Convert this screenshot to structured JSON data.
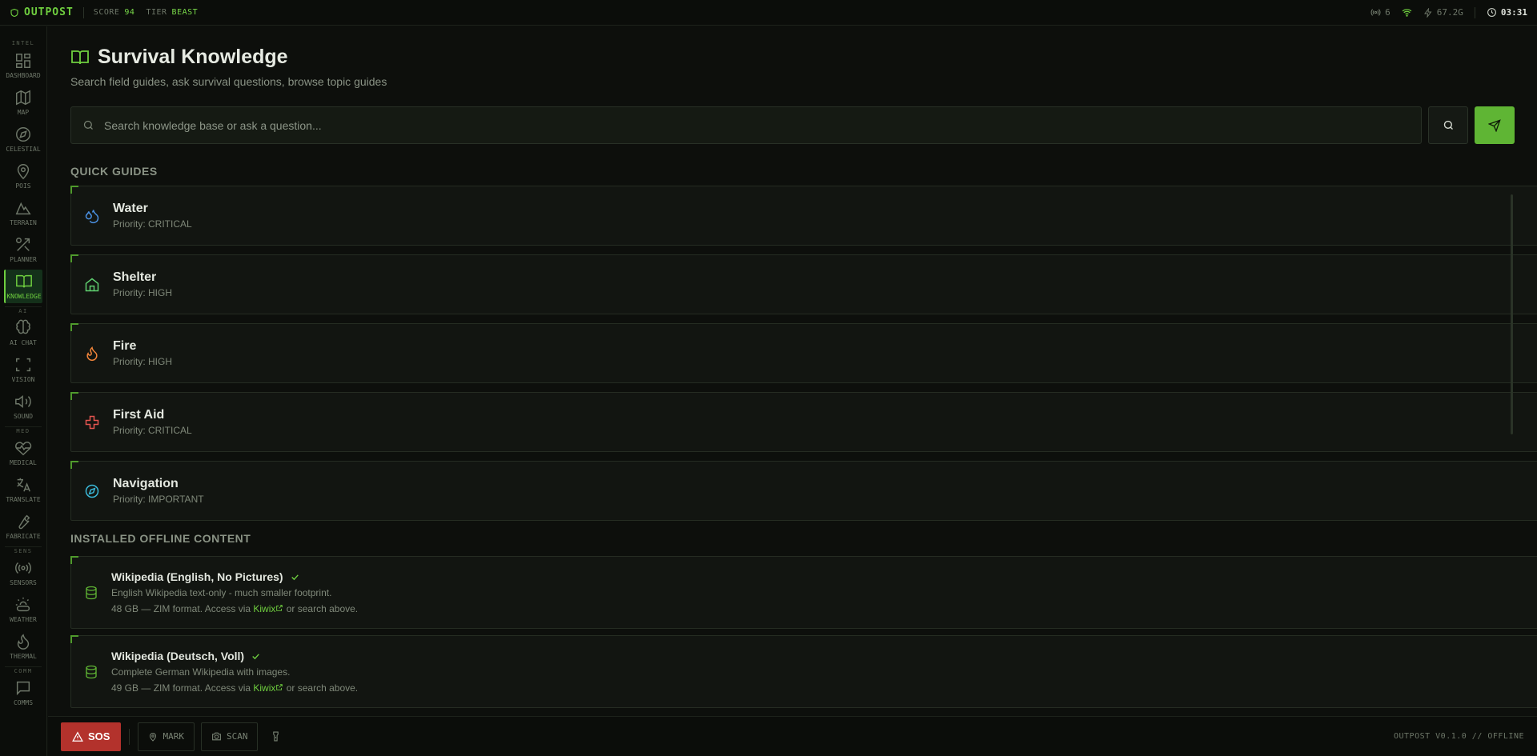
{
  "topbar": {
    "brand": "OUTPOST",
    "score_label": "SCORE",
    "score_value": "94",
    "tier_label": "TIER",
    "tier_value": "BEAST",
    "signal_count": "6",
    "freq": "67.2G",
    "clock": "03:31"
  },
  "sidebar": {
    "sections": {
      "intel": "INTEL",
      "ai": "AI",
      "med": "MED",
      "sens": "SENS",
      "comm": "COMM"
    },
    "items": [
      {
        "label": "DASHBOARD",
        "icon": "dashboard-icon"
      },
      {
        "label": "MAP",
        "icon": "map-icon"
      },
      {
        "label": "CELESTIAL",
        "icon": "compass-icon"
      },
      {
        "label": "POIS",
        "icon": "pin-icon"
      },
      {
        "label": "TERRAIN",
        "icon": "mountain-icon"
      },
      {
        "label": "PLANNER",
        "icon": "planner-icon"
      },
      {
        "label": "KNOWLEDGE",
        "icon": "book-icon"
      },
      {
        "label": "AI CHAT",
        "icon": "brain-icon"
      },
      {
        "label": "VISION",
        "icon": "scan-icon"
      },
      {
        "label": "SOUND",
        "icon": "speaker-icon"
      },
      {
        "label": "MEDICAL",
        "icon": "heartbeat-icon"
      },
      {
        "label": "TRANSLATE",
        "icon": "translate-icon"
      },
      {
        "label": "FABRICATE",
        "icon": "wrench-icon"
      },
      {
        "label": "SENSORS",
        "icon": "radio-icon"
      },
      {
        "label": "WEATHER",
        "icon": "weather-icon"
      },
      {
        "label": "THERMAL",
        "icon": "flame-icon"
      },
      {
        "label": "COMMS",
        "icon": "chat-icon"
      }
    ]
  },
  "main": {
    "title": "Survival Knowledge",
    "subtitle": "Search field guides, ask survival questions, browse topic guides",
    "search_placeholder": "Search knowledge base or ask a question...",
    "quick_guides_heading": "QUICK GUIDES",
    "guides": [
      {
        "title": "Water",
        "priority": "Priority: CRITICAL",
        "icon": "droplets-icon",
        "color": "#4a90e2"
      },
      {
        "title": "Shelter",
        "priority": "Priority: HIGH",
        "icon": "home-icon",
        "color": "#5fcf70"
      },
      {
        "title": "Fire",
        "priority": "Priority: HIGH",
        "icon": "flame-icon",
        "color": "#f0843a"
      },
      {
        "title": "First Aid",
        "priority": "Priority: CRITICAL",
        "icon": "plus-icon",
        "color": "#e2554f"
      },
      {
        "title": "Navigation",
        "priority": "Priority: IMPORTANT",
        "icon": "compass-icon",
        "color": "#3ab8d8"
      }
    ],
    "installed_heading": "INSTALLED OFFLINE CONTENT",
    "content": [
      {
        "title": "Wikipedia (English, No Pictures)",
        "desc": "English Wikipedia text-only - much smaller footprint.",
        "meta_pre": "48 GB — ZIM format. Access via",
        "link": "Kiwix",
        "meta_post": "or search above."
      },
      {
        "title": "Wikipedia (Deutsch, Voll)",
        "desc": "Complete German Wikipedia with images.",
        "meta_pre": "49 GB — ZIM format. Access via",
        "link": "Kiwix",
        "meta_post": "or search above."
      }
    ]
  },
  "bottombar": {
    "sos": "SOS",
    "mark": "MARK",
    "scan": "SCAN",
    "version": "OUTPOST V0.1.0 // OFFLINE"
  }
}
